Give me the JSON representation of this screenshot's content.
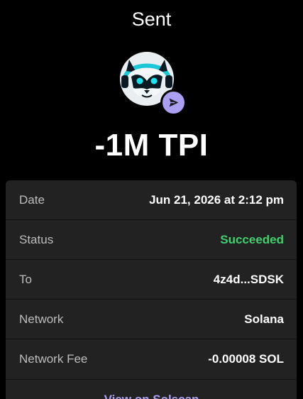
{
  "header": {
    "title": "Sent"
  },
  "token": {
    "icon": "raccoon-token-logo",
    "badge_icon": "send-arrow-icon",
    "badge_color": "#ab9ff2"
  },
  "amount": "-1M TPI",
  "details": {
    "rows": [
      {
        "label": "Date",
        "value": "Jun 21, 2026 at 2:12 pm"
      },
      {
        "label": "Status",
        "value": "Succeeded"
      },
      {
        "label": "To",
        "value": "4z4d...SDSK"
      },
      {
        "label": "Network",
        "value": "Solana"
      },
      {
        "label": "Network Fee",
        "value": "-0.00008 SOL"
      }
    ]
  },
  "footer": {
    "link_label": "View on Solscan"
  },
  "colors": {
    "background": "#000000",
    "card": "#222222",
    "success": "#3fcf6e",
    "accent": "#ab9ff2"
  }
}
